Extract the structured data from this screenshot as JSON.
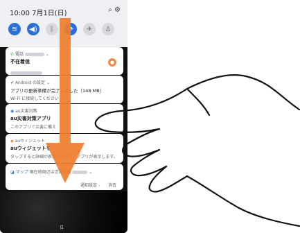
{
  "status": {
    "time": "10:00",
    "date": "7月1日(日)"
  },
  "quick_settings": [
    {
      "name": "wifi",
      "icon": "≋",
      "active": true
    },
    {
      "name": "sound",
      "icon": "◀)",
      "active": true
    },
    {
      "name": "bluetooth",
      "icon": "ᛒ",
      "active": false
    },
    {
      "name": "autorotate",
      "icon": "⟳",
      "active": true
    },
    {
      "name": "airplane",
      "icon": "✈",
      "active": false
    },
    {
      "name": "flashlight",
      "icon": "♙",
      "active": false
    }
  ],
  "notifications": {
    "phone": {
      "app": "電話",
      "title": "不在着信"
    },
    "android": {
      "app": "Android の設定",
      "title": "アプリの更新準備が完了しました（148 MB）",
      "sub": "Wi-Fi に接続してください"
    },
    "au_saigai": {
      "app": "au災害対策",
      "title": "au災害対策アプリ",
      "sub": "このアプリで災害に備え"
    },
    "au_widget": {
      "app": "auウィジェット",
      "title": "auウィジェットを",
      "sub": "タップすると詳細が表示されます。アプリが表示します。"
    },
    "map": {
      "app": "マップ",
      "text": "現在地周辺は渋滞傾向"
    }
  },
  "footer": {
    "settings": "通知設定",
    "clear": "消去"
  },
  "blur_label": "日"
}
